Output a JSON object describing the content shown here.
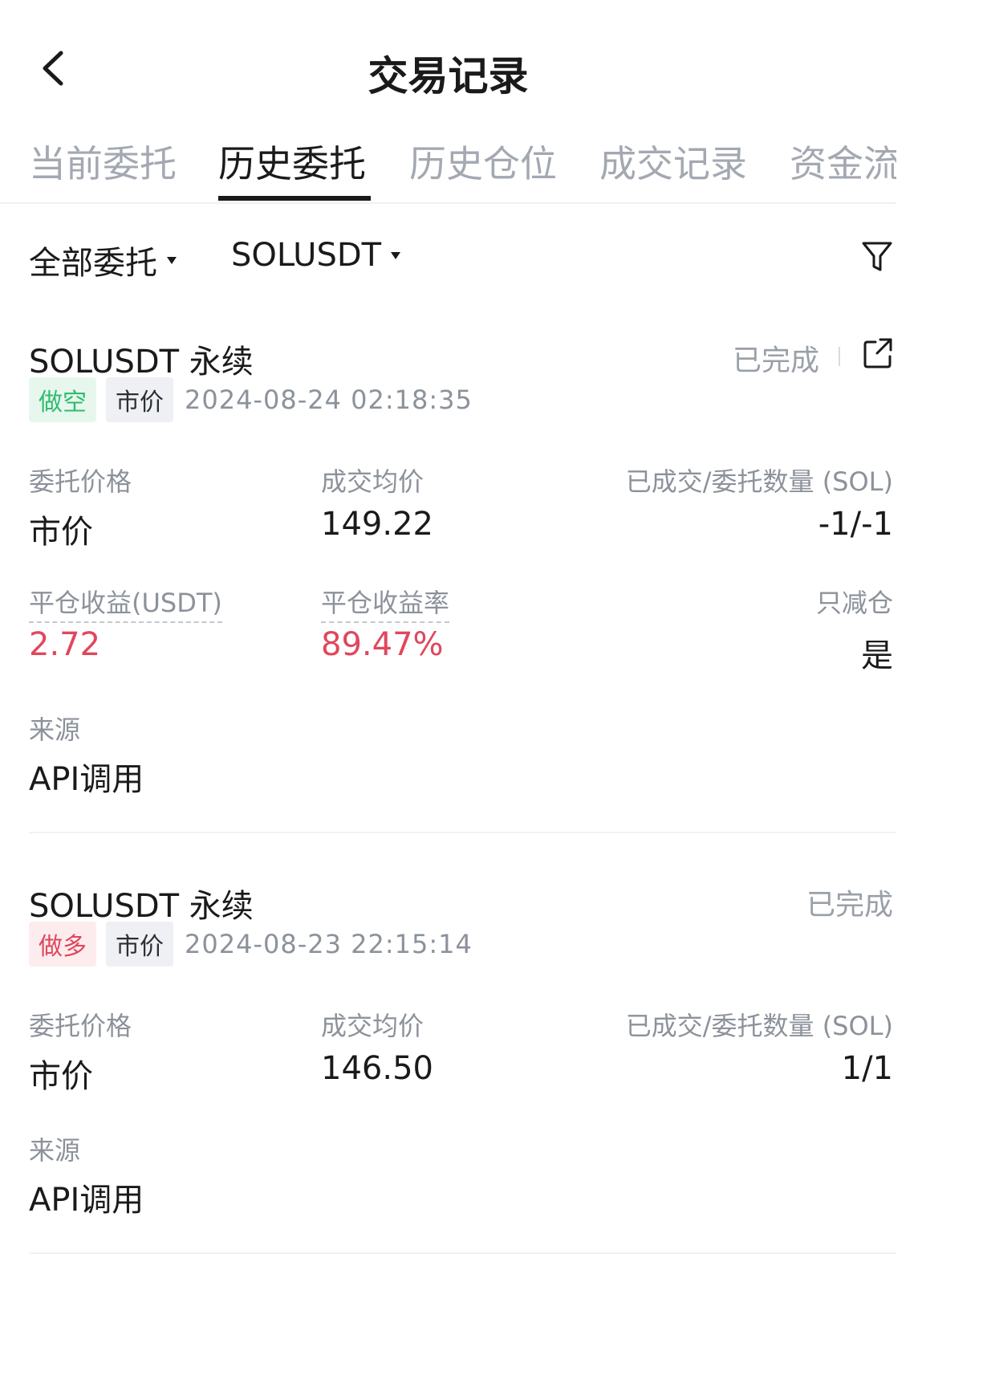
{
  "header": {
    "title": "交易记录"
  },
  "tabs": [
    {
      "label": "当前委托"
    },
    {
      "label": "历史委托"
    },
    {
      "label": "历史仓位"
    },
    {
      "label": "成交记录"
    },
    {
      "label": "资金流"
    }
  ],
  "filters": {
    "type": "全部委托",
    "symbol": "SOLUSDT"
  },
  "orders": [
    {
      "title": "SOLUSDT 永续",
      "status": "已完成",
      "side": "做空",
      "order_type": "市价",
      "time": "2024-08-24 02:18:35",
      "price_label": "委托价格",
      "price_value": "市价",
      "avg_label": "成交均价",
      "avg_value": "149.22",
      "qty_label": "已成交/委托数量 (SOL)",
      "qty_value": "-1/-1",
      "pnl_label": "平仓收益(USDT)",
      "pnl_value": "2.72",
      "pnl_rate_label": "平仓收益率",
      "pnl_rate_value": "89.47%",
      "reduce_only_label": "只减仓",
      "reduce_only_value": "是",
      "source_label": "来源",
      "source_value": "API调用"
    },
    {
      "title": "SOLUSDT 永续",
      "status": "已完成",
      "side": "做多",
      "order_type": "市价",
      "time": "2024-08-23 22:15:14",
      "price_label": "委托价格",
      "price_value": "市价",
      "avg_label": "成交均价",
      "avg_value": "146.50",
      "qty_label": "已成交/委托数量 (SOL)",
      "qty_value": "1/1",
      "source_label": "来源",
      "source_value": "API调用"
    }
  ],
  "colors": {
    "positive": "#e0475d",
    "short": "#2ebd6f",
    "muted": "#8c929b"
  }
}
